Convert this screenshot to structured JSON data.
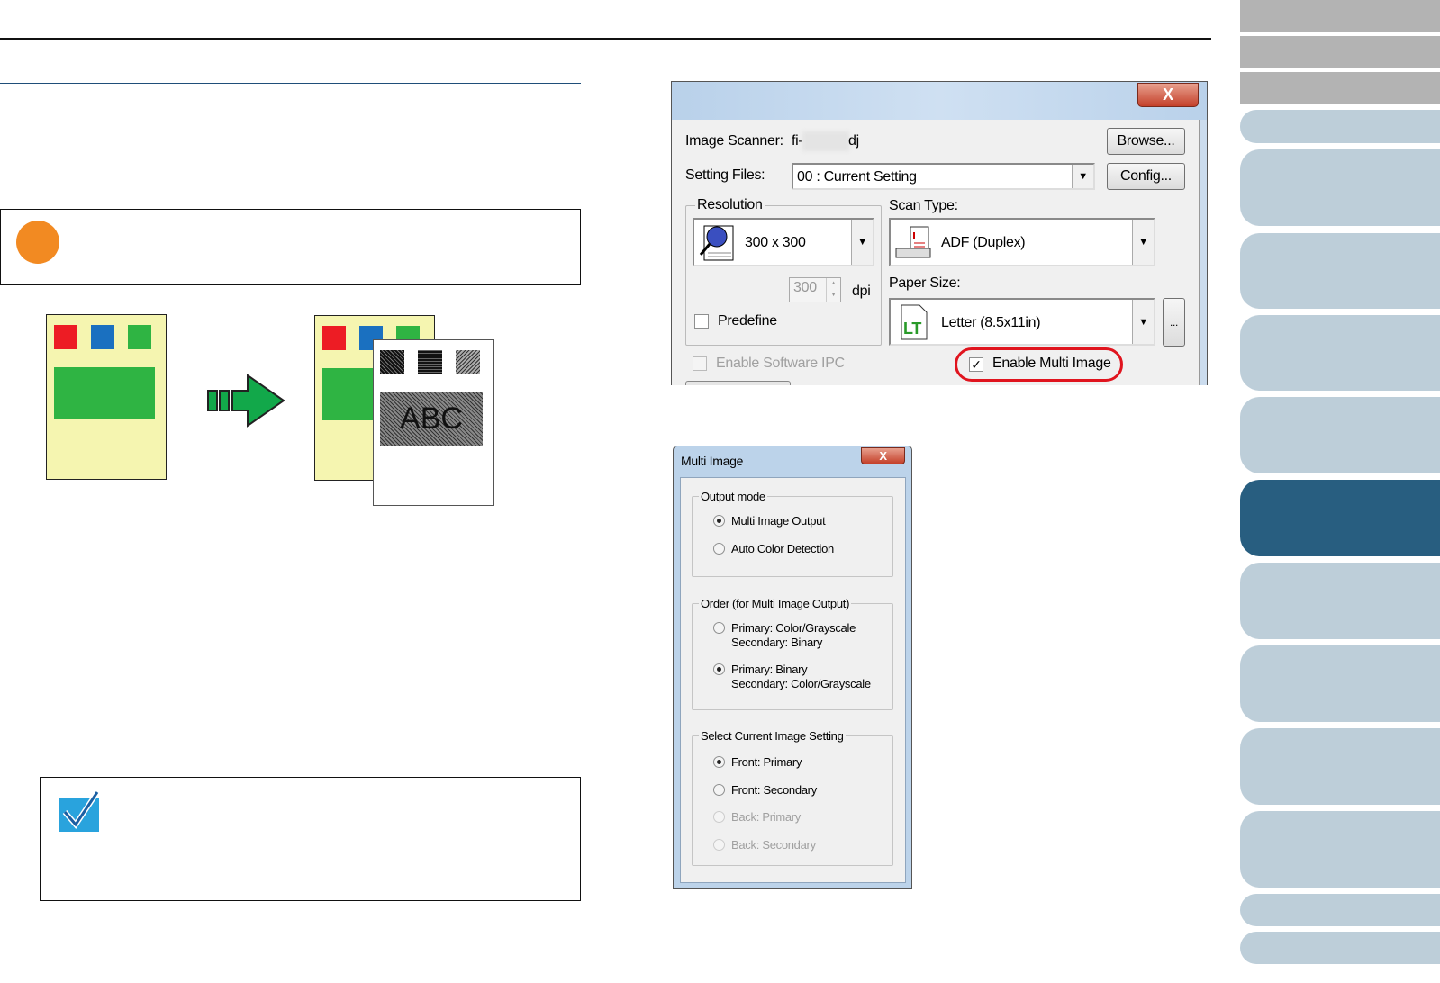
{
  "scanner_dialog": {
    "close_label": "X",
    "image_scanner_label": "Image Scanner:",
    "image_scanner_prefix": "fi-",
    "image_scanner_suffix": "dj",
    "browse_label": "Browse...",
    "setting_files_label": "Setting Files:",
    "setting_files_value": "00 : Current Setting",
    "config_label": "Config...",
    "resolution_label": "Resolution",
    "resolution_value": "300 x 300",
    "dpi_value": "300",
    "dpi_label": "dpi",
    "predefine_label": "Predefine",
    "scan_type_label": "Scan Type:",
    "scan_type_value": "ADF (Duplex)",
    "paper_size_label": "Paper Size:",
    "paper_size_value": "Letter (8.5x11in)",
    "paper_more_label": "...",
    "software_ipc_label": "Enable Software IPC",
    "multi_image_label": "Enable Multi Image",
    "multi_image_checked": true,
    "highlight_color": "#e0141e"
  },
  "multi_image_dialog": {
    "title": "Multi Image",
    "close_label": "X",
    "output_mode": {
      "label": "Output mode",
      "options": [
        "Multi Image Output",
        "Auto Color Detection"
      ],
      "selected": 0
    },
    "order": {
      "label": "Order (for Multi Image Output)",
      "options": [
        [
          "Primary: Color/Grayscale",
          "Secondary: Binary"
        ],
        [
          "Primary: Binary",
          "Secondary: Color/Grayscale"
        ]
      ],
      "selected": 1
    },
    "select_current": {
      "label": "Select Current Image Setting",
      "options": [
        "Front: Primary",
        "Front: Secondary",
        "Back: Primary",
        "Back: Secondary"
      ],
      "selected": 0
    }
  },
  "illustration": {
    "text": "ABC"
  },
  "colors": {
    "accent": "#285e80",
    "tab": "#bdced9",
    "attention": "#f28a22"
  }
}
